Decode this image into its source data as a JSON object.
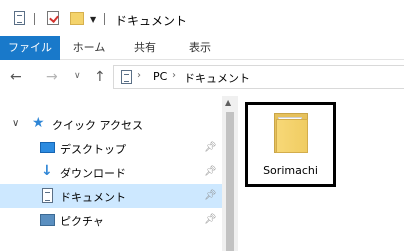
{
  "window": {
    "title": "ドキュメント",
    "quick_access_toolbar": [
      "properties-icon",
      "check-icon",
      "new-folder-icon",
      "dropdown-icon"
    ]
  },
  "ribbon": {
    "tabs": [
      {
        "label": "ファイル",
        "active": true
      },
      {
        "label": "ホーム"
      },
      {
        "label": "共有"
      },
      {
        "label": "表示"
      }
    ],
    "file_tab_color": "#1979ca"
  },
  "address_bar": {
    "icon": "documents-icon",
    "path": [
      "PC",
      "ドキュメント"
    ]
  },
  "navigation_pane": {
    "quick_access": {
      "label": "クイック アクセス",
      "icon": "star-icon",
      "expanded": true,
      "items": [
        {
          "label": "デスクトップ",
          "icon": "desktop-icon",
          "pinned": true,
          "selected": false
        },
        {
          "label": "ダウンロード",
          "icon": "download-icon",
          "pinned": true,
          "selected": false
        },
        {
          "label": "ドキュメント",
          "icon": "documents-icon",
          "pinned": true,
          "selected": true
        },
        {
          "label": "ピクチャ",
          "icon": "pictures-icon",
          "pinned": true,
          "selected": false
        }
      ]
    },
    "selected_color": "#cde8ff"
  },
  "content": {
    "items": [
      {
        "name": "Sorimachi",
        "type": "folder",
        "icon": "folder-icon",
        "highlighted": true
      }
    ]
  }
}
